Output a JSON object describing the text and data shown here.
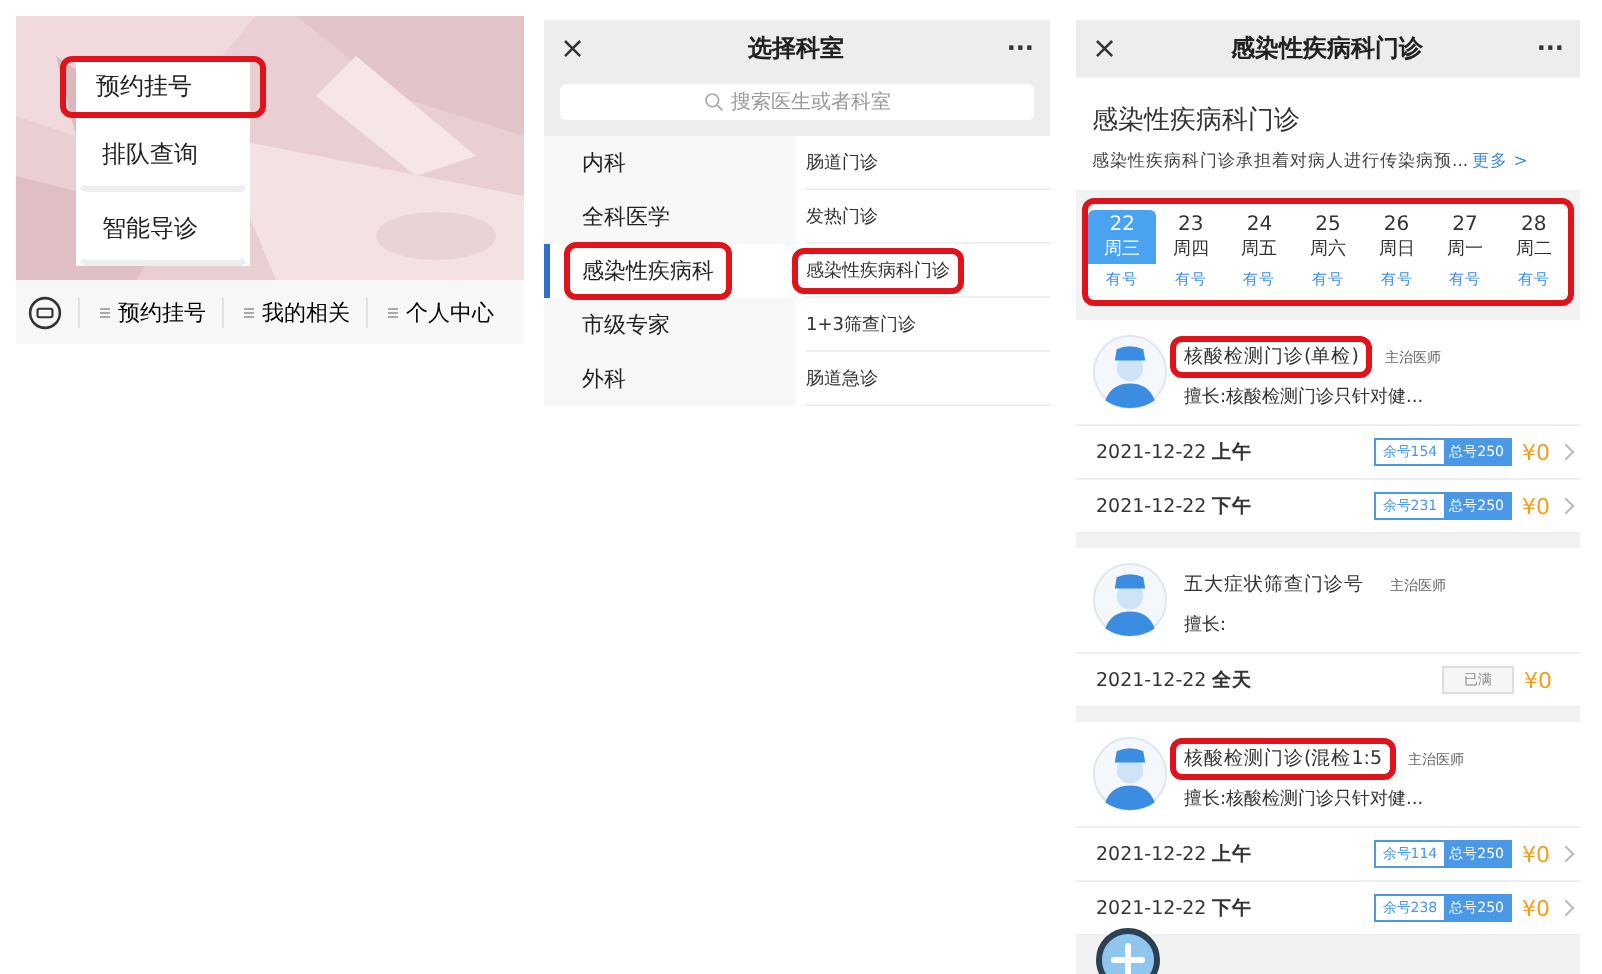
{
  "menu_screen": {
    "popup_menu": [
      {
        "label": "预约挂号",
        "highlighted": true
      },
      {
        "label": "排队查询",
        "highlighted": false
      },
      {
        "label": "智能导诊",
        "highlighted": false
      }
    ],
    "bottom_bar": [
      {
        "label": "预约挂号"
      },
      {
        "label": "我的相关"
      },
      {
        "label": "个人中心"
      }
    ]
  },
  "department_screen": {
    "title": "选择科室",
    "close": "×",
    "more": "···",
    "search": {
      "placeholder": "搜索医生或者科室"
    },
    "departments": [
      {
        "label": "内科",
        "selected": false,
        "highlighted": false
      },
      {
        "label": "全科医学",
        "selected": false,
        "highlighted": false
      },
      {
        "label": "感染性疾病科",
        "selected": true,
        "highlighted": true
      },
      {
        "label": "市级专家",
        "selected": false,
        "highlighted": false
      },
      {
        "label": "外科",
        "selected": false,
        "highlighted": false
      }
    ],
    "clinics": [
      {
        "label": "肠道门诊",
        "highlighted": false
      },
      {
        "label": "发热门诊",
        "highlighted": false
      },
      {
        "label": "感染性疾病科门诊",
        "highlighted": true
      },
      {
        "label": "1+3筛查门诊",
        "highlighted": false
      },
      {
        "label": "肠道急诊",
        "highlighted": false
      }
    ]
  },
  "clinic_screen": {
    "title": "感染性疾病科门诊",
    "close": "×",
    "more": "···",
    "intro": {
      "heading": "感染性疾病科门诊",
      "description": "感染性疾病科门诊承担着对病人进行传染病预...",
      "more_link": "更多 >"
    },
    "dates_highlighted": true,
    "dates": [
      {
        "day": "22",
        "weekday": "周三",
        "availability": "有号",
        "selected": true
      },
      {
        "day": "23",
        "weekday": "周四",
        "availability": "有号",
        "selected": false
      },
      {
        "day": "24",
        "weekday": "周五",
        "availability": "有号",
        "selected": false
      },
      {
        "day": "25",
        "weekday": "周六",
        "availability": "有号",
        "selected": false
      },
      {
        "day": "26",
        "weekday": "周日",
        "availability": "有号",
        "selected": false
      },
      {
        "day": "27",
        "weekday": "周一",
        "availability": "有号",
        "selected": false
      },
      {
        "day": "28",
        "weekday": "周二",
        "availability": "有号",
        "selected": false
      }
    ],
    "doctors": [
      {
        "name": "核酸检测门诊(单检)",
        "title": "主治医师",
        "specialty": "擅长:核酸检测门诊只针对健...",
        "highlighted": true,
        "slots": [
          {
            "kind": "available",
            "date": "2021-12-22",
            "period": "上午",
            "remaining": "余号154",
            "total": "总号250",
            "price": "¥0"
          },
          {
            "kind": "available",
            "date": "2021-12-22",
            "period": "下午",
            "remaining": "余号231",
            "total": "总号250",
            "price": "¥0"
          }
        ]
      },
      {
        "name": "五大症状筛查门诊号",
        "title": "主治医师",
        "specialty": "擅长:",
        "highlighted": false,
        "slots": [
          {
            "kind": "full",
            "date": "2021-12-22",
            "period": "全天",
            "status": "已满",
            "price": "¥0"
          }
        ]
      },
      {
        "name": "核酸检测门诊(混检1:5",
        "title": "主治医师",
        "specialty": "擅长:核酸检测门诊只针对健...",
        "highlighted": true,
        "slots": [
          {
            "kind": "available",
            "date": "2021-12-22",
            "period": "上午",
            "remaining": "余号114",
            "total": "总号250",
            "price": "¥0"
          },
          {
            "kind": "available",
            "date": "2021-12-22",
            "period": "下午",
            "remaining": "余号238",
            "total": "总号250",
            "price": "¥0"
          }
        ]
      }
    ]
  }
}
